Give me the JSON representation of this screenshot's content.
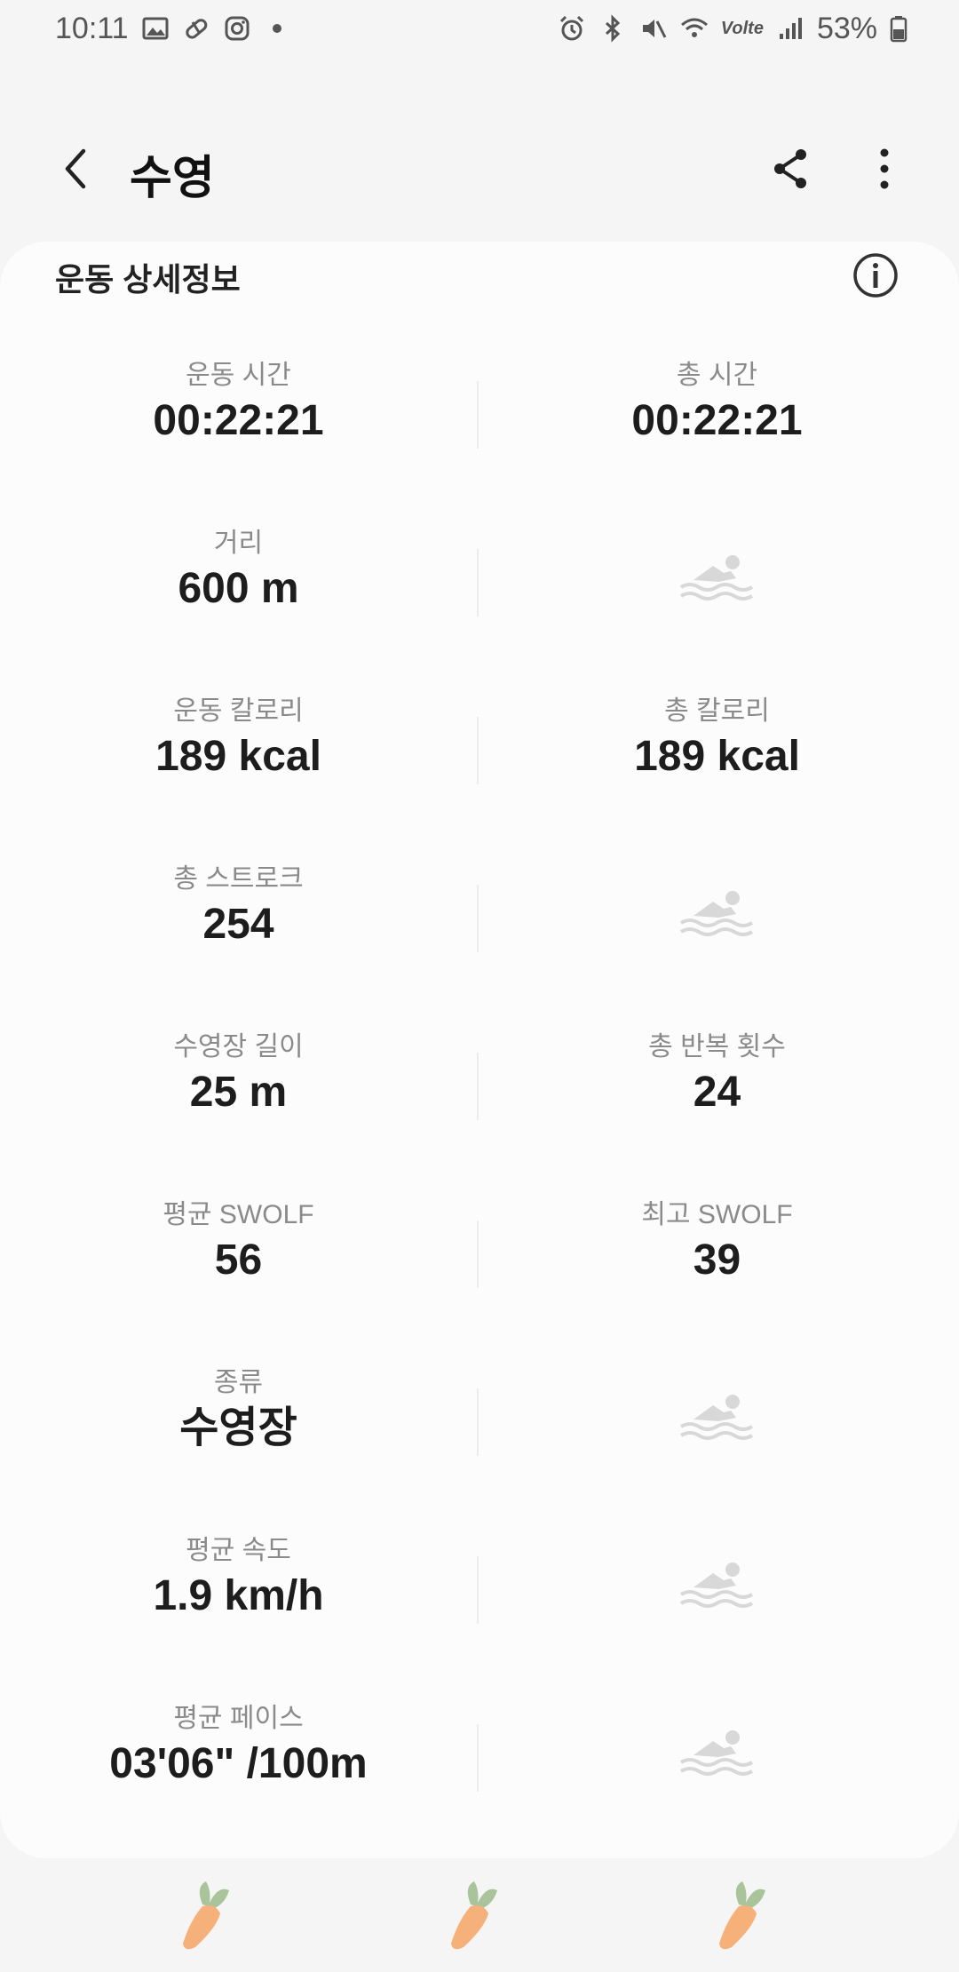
{
  "status_bar": {
    "time": "10:11",
    "battery": "53%",
    "network": "Volte"
  },
  "header": {
    "title": "수영"
  },
  "card": {
    "title": "운동 상세정보",
    "rows": [
      {
        "left": {
          "label": "운동 시간",
          "value": "00:22:21"
        },
        "right": {
          "label": "총 시간",
          "value": "00:22:21"
        }
      },
      {
        "left": {
          "label": "거리",
          "value": "600 m"
        },
        "right": {
          "icon": "swimmer-icon"
        }
      },
      {
        "left": {
          "label": "운동 칼로리",
          "value": "189 kcal"
        },
        "right": {
          "label": "총 칼로리",
          "value": "189 kcal"
        }
      },
      {
        "left": {
          "label": "총 스트로크",
          "value": "254"
        },
        "right": {
          "icon": "swimmer-icon"
        }
      },
      {
        "left": {
          "label": "수영장 길이",
          "value": "25 m"
        },
        "right": {
          "label": "총 반복 횟수",
          "value": "24"
        }
      },
      {
        "left": {
          "label": "평균 SWOLF",
          "value": "56"
        },
        "right": {
          "label": "최고 SWOLF",
          "value": "39"
        }
      },
      {
        "left": {
          "label": "종류",
          "value": "수영장"
        },
        "right": {
          "icon": "swimmer-icon"
        }
      },
      {
        "left": {
          "label": "평균 속도",
          "value": "1.9 km/h"
        },
        "right": {
          "icon": "swimmer-icon"
        }
      },
      {
        "left": {
          "label": "평균 페이스",
          "value": "03'06\" /100m"
        },
        "right": {
          "icon": "swimmer-icon"
        }
      }
    ]
  },
  "bottom_nav": {
    "icons": [
      "carrot-icon",
      "carrot-icon",
      "carrot-icon"
    ]
  },
  "colors": {
    "background": "#f5f5f5",
    "card": "#fcfcfc",
    "label": "#8a8a8a",
    "value": "#1d1d1d",
    "swimmer": "#d8d8d8"
  }
}
